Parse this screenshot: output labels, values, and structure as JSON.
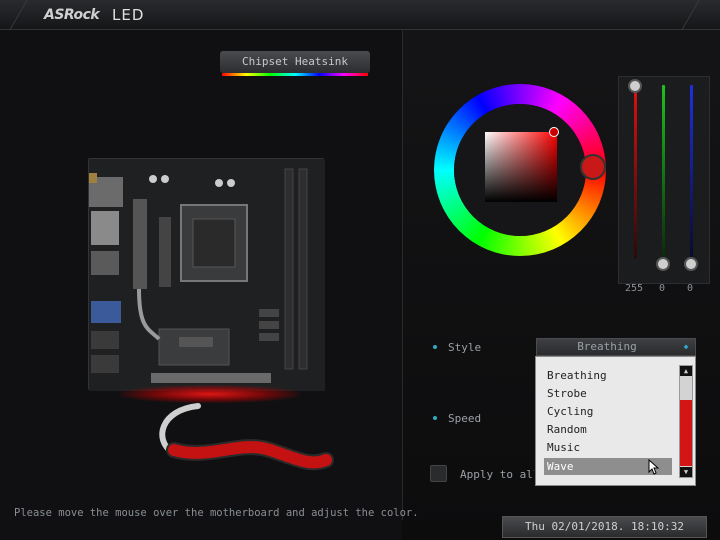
{
  "window": {
    "brand": "ASRock",
    "title": "LED"
  },
  "zone": {
    "label": "Chipset Heatsink"
  },
  "instructions": "Please move the mouse over the motherboard and adjust the color.",
  "color": {
    "rgb_values": [
      "255",
      "0",
      "0"
    ],
    "current_hex": "#ff0000"
  },
  "style": {
    "label": "Style",
    "selected": "Breathing",
    "options": [
      "Breathing",
      "Strobe",
      "Cycling",
      "Random",
      "Music",
      "Wave"
    ],
    "highlighted": "Wave"
  },
  "speed": {
    "label": "Speed"
  },
  "apply_all": {
    "label": "Apply to all"
  },
  "datetime": "Thu 02/01/2018. 18:10:32",
  "colors": {
    "accent": "#2fa8c8",
    "red": "#d41515",
    "bg": "#101012"
  }
}
